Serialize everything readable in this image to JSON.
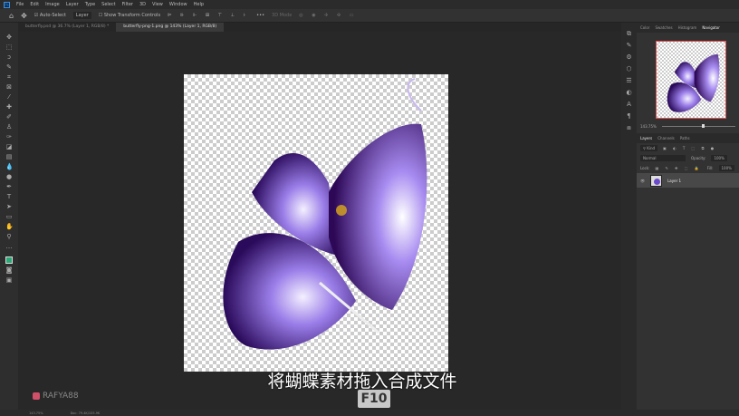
{
  "menu": [
    "File",
    "Edit",
    "Image",
    "Layer",
    "Type",
    "Select",
    "Filter",
    "3D",
    "View",
    "Window",
    "Help"
  ],
  "options": {
    "auto_select": "Auto-Select",
    "layer_select": "Layer",
    "transform": "Show Transform Controls",
    "mode3d": "3D Mode"
  },
  "tabs": [
    {
      "label": "butterfly.psd @ 36.7% (Layer 1, RGB/8) *",
      "active": false
    },
    {
      "label": "butterfly-png-1.png @ 143% (Layer 1, RGB/8)",
      "active": true
    }
  ],
  "panels": {
    "top_tabs": [
      "Color",
      "Swatches",
      "Histogram",
      "Navigator"
    ],
    "nav_zoom": "143.75%",
    "layer_tabs": [
      "Layers",
      "Channels",
      "Paths"
    ],
    "kind": "Kind",
    "blend": "Normal",
    "opacity_label": "Opacity:",
    "opacity": "100%",
    "lock_label": "Lock:",
    "fill_label": "Fill:",
    "fill": "100%",
    "layer_name": "Layer 1"
  },
  "status": {
    "zoom": "143.75%",
    "doc": "Doc: 79.4K/105.9K"
  },
  "subtitle": "将蝴蝶素材拖入合成文件",
  "keycap": "F10",
  "watermark": "RAFYA88",
  "colors": {
    "accent": "#3b8de0",
    "foreground": "#2aa876"
  }
}
